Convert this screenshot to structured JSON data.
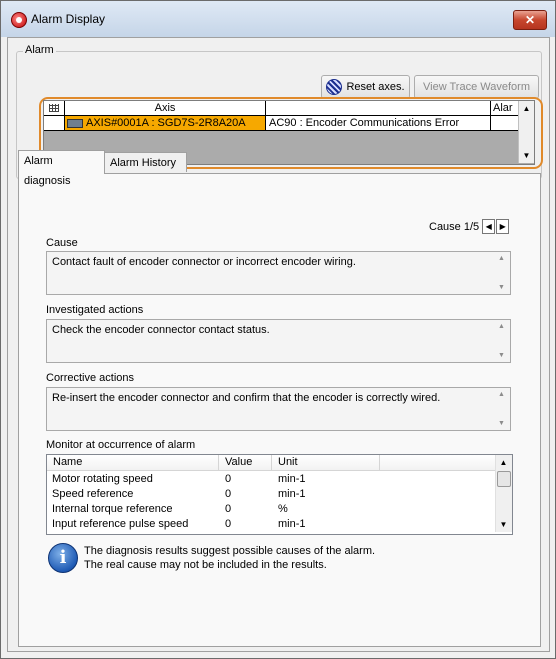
{
  "window": {
    "title": "Alarm Display",
    "close_glyph": "✕"
  },
  "alarm_group": {
    "label": "Alarm",
    "reset_button": "Reset axes.",
    "trace_button": "View Trace Waveform",
    "grid": {
      "columns": [
        "Axis",
        "",
        "Alar"
      ],
      "rows": [
        {
          "axis": "AXIS#0001A : SGD7S-2R8A20A",
          "alarm": "AC90 : Encoder Communications Error",
          "extra": ""
        }
      ]
    }
  },
  "tabs": [
    {
      "label": "Alarm diagnosis",
      "active": true
    },
    {
      "label": "Alarm History",
      "active": false
    }
  ],
  "diagnosis": {
    "cause_counter": "Cause 1/5",
    "cause": {
      "label": "Cause",
      "text": "Contact fault of encoder connector or incorrect encoder wiring."
    },
    "investigated": {
      "label": "Investigated actions",
      "text": "Check the encoder connector contact status."
    },
    "corrective": {
      "label": "Corrective actions",
      "text": "Re-insert the encoder connector and confirm that the encoder is correctly wired."
    },
    "monitor": {
      "label": "Monitor at occurrence of alarm",
      "columns": [
        "Name",
        "Value",
        "Unit"
      ],
      "rows": [
        {
          "name": "Motor rotating speed",
          "value": "0",
          "unit": "min-1"
        },
        {
          "name": "Speed reference",
          "value": "0",
          "unit": "min-1"
        },
        {
          "name": "Internal torque reference",
          "value": "0",
          "unit": "%"
        },
        {
          "name": "Input reference pulse speed",
          "value": "0",
          "unit": "min-1"
        }
      ]
    },
    "info_line1": "The diagnosis results suggest possible causes of the alarm.",
    "info_line2": "The real cause may not be included in the results."
  },
  "colors": {
    "selected_row": "#f6a800",
    "highlight_border": "#e08a2b",
    "close_button": "#c7472e"
  },
  "icons": [
    "alarm-app-icon",
    "close-icon",
    "reset-axes-icon",
    "axis-device-icon",
    "info-icon",
    "scroll-up-icon",
    "scroll-down-icon",
    "prev-arrow-icon",
    "next-arrow-icon"
  ]
}
